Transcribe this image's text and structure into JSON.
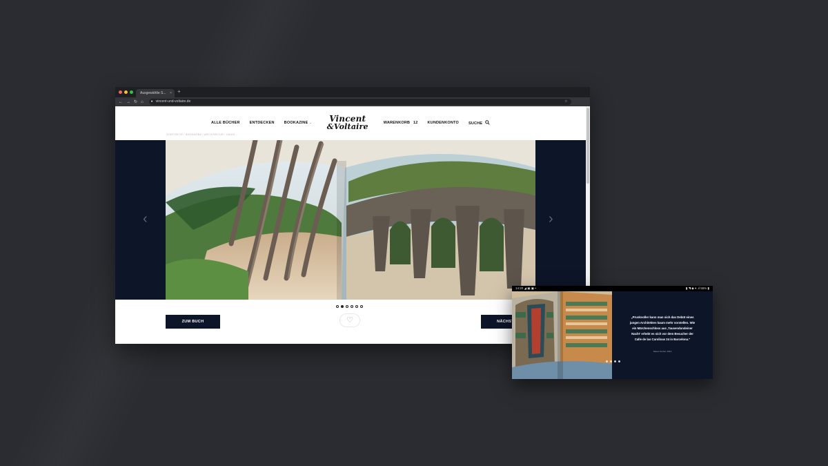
{
  "browser": {
    "tab_title": "Ausgewählte S...",
    "tab_close": "×",
    "new_tab": "+",
    "url": "vincent-und-voltaire.de",
    "traffic_colors": [
      "#ff5f57",
      "#febc2e",
      "#28c840"
    ]
  },
  "site": {
    "nav": {
      "all_books": "ALLE BÜCHER",
      "discover": "ENTDECKEN",
      "bookazine": "BOOKAZINE",
      "cart": "WARENKORB",
      "cart_count": "12",
      "account": "KUNDENKONTO",
      "search": "SUCHE"
    },
    "logo": {
      "line1": "Vincent",
      "line2": "&Voltaire"
    },
    "breadcrumb": "STARTSEITE  /  BOOKAZINE  /  ARCHITEKTUR  /  GAUDÍ...",
    "hero": {
      "prev_arrow": "‹",
      "next_arrow": "›",
      "active_slide": 1,
      "slide_count": 6
    },
    "buttons": {
      "to_book": "ZUM BUCH",
      "next": "NÄCHSTES"
    },
    "favorite_icon": "♡"
  },
  "tablet": {
    "status_left": "14:20  ◢ ▣ ▣ •",
    "status_right": "▮ ◥ ◆ ▾ .ıl 55% ▮",
    "quote": "„Prunkvoller kann man sich das Debüt eines jungen Architekten kaum mehr vorstellen. Wie ein Märchenschloss aus ‚Tausendundeiner Nacht‘ erhebt es sich vor dem Besucher der Calle de las Carolinas 24 in Barcelona.\"",
    "source": "Rainer Zerbst, 2019",
    "slide_count": 5,
    "active_slide": 0
  },
  "colors": {
    "navy": "#0d1528",
    "background": "#2b2c31"
  }
}
